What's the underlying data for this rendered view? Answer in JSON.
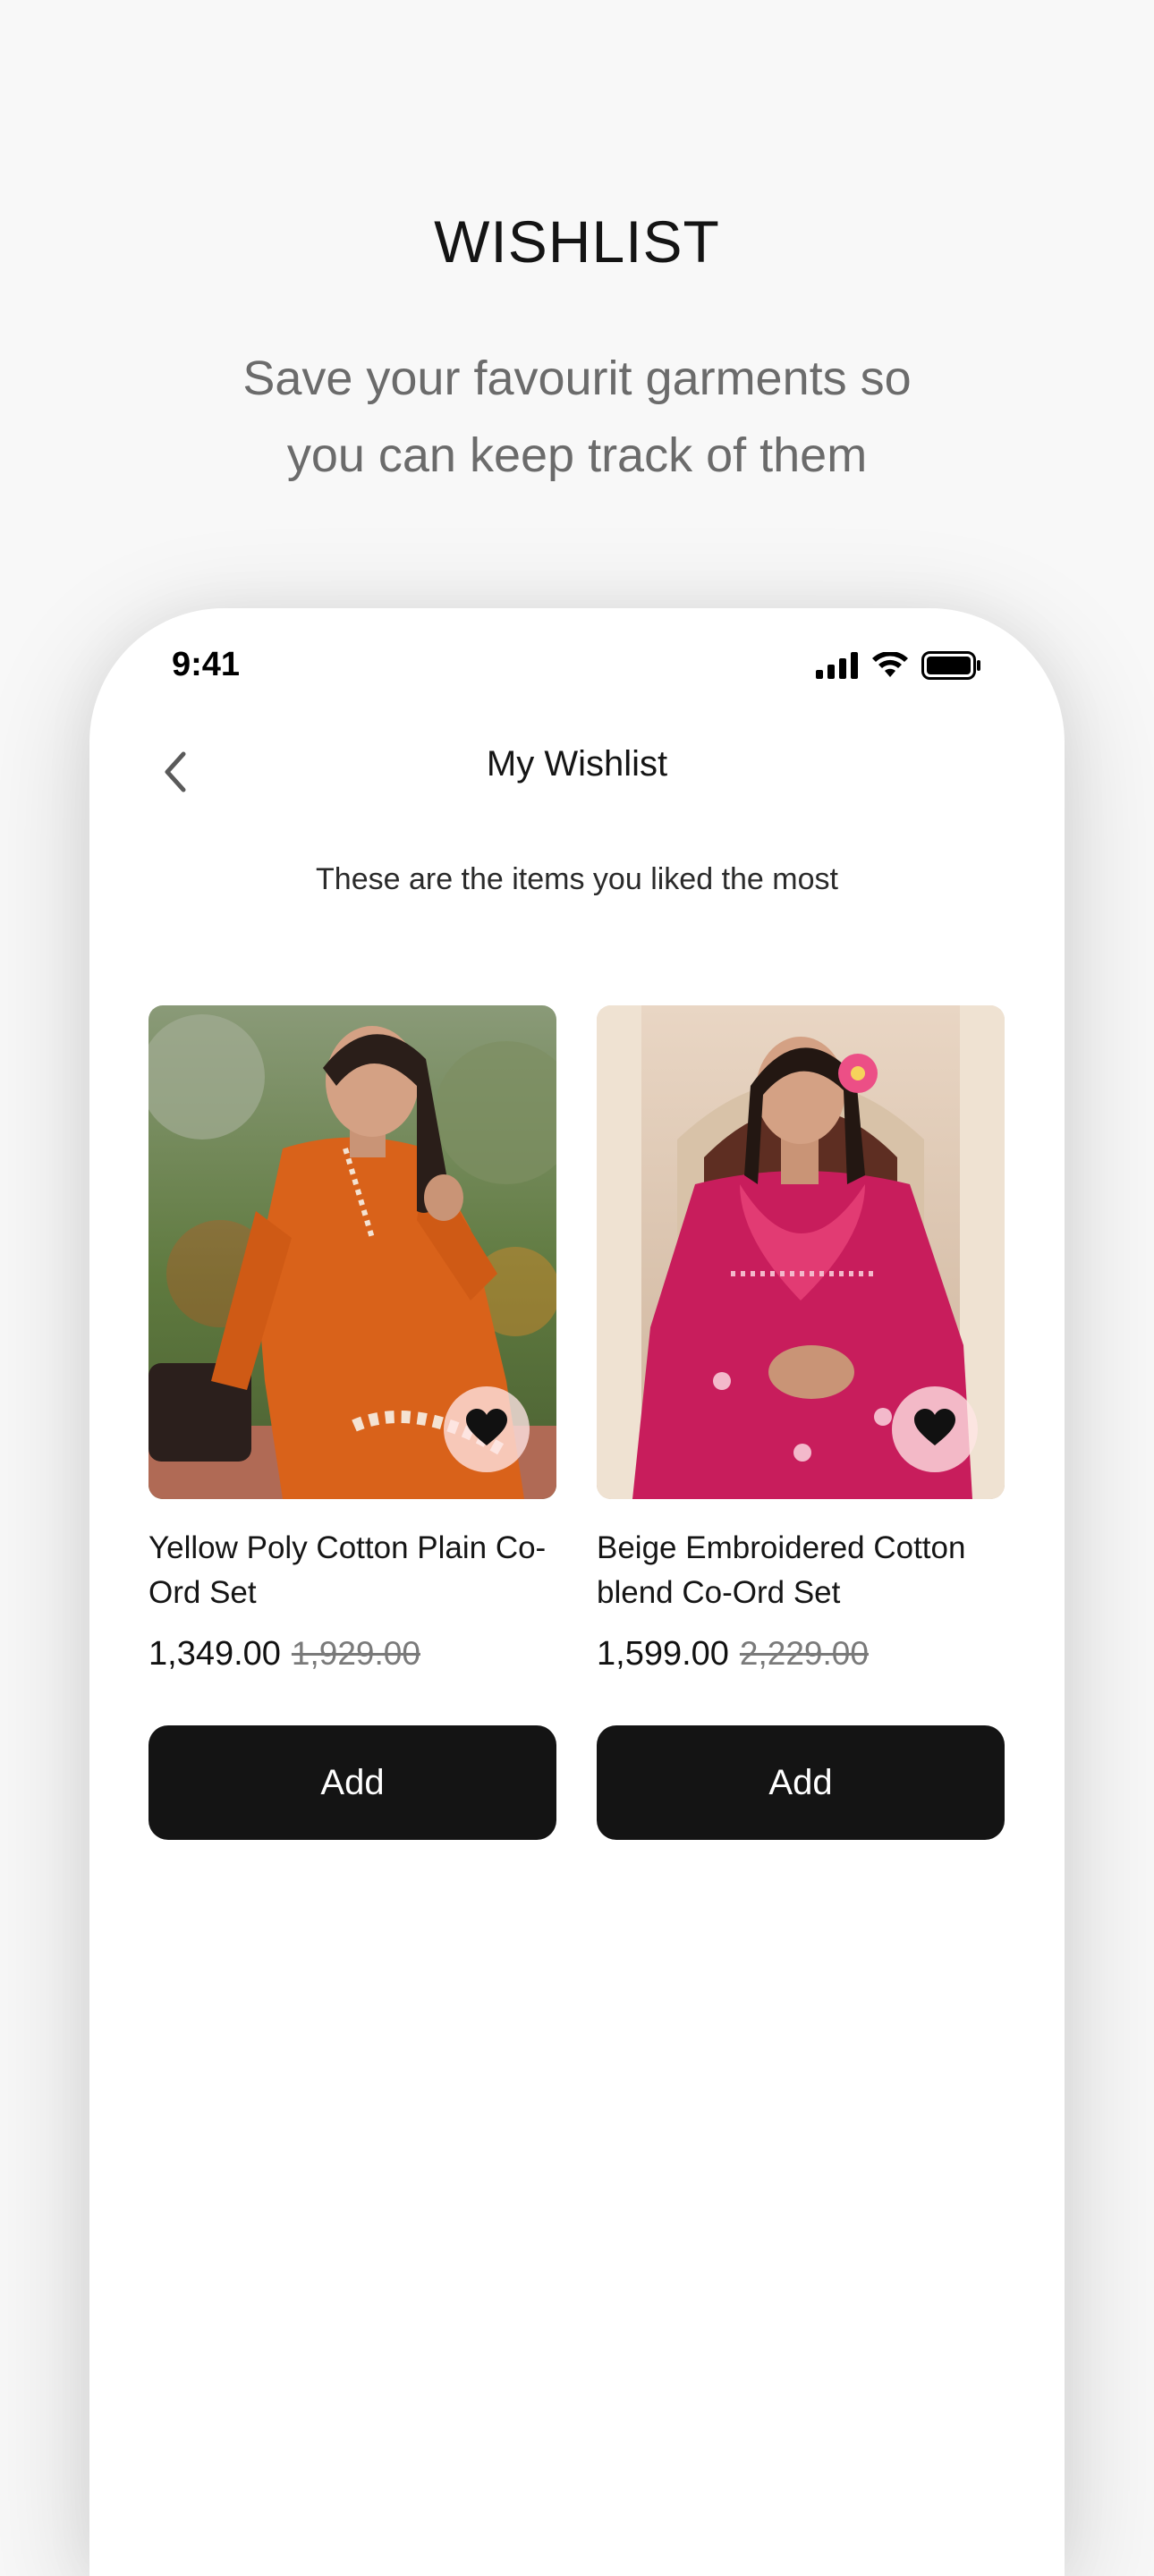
{
  "promo": {
    "title": "WISHLIST",
    "subtitle_line1": "Save your favourit garments so",
    "subtitle_line2": "you can keep track of them"
  },
  "status_bar": {
    "time": "9:41",
    "icons": [
      "cellular-signal-icon",
      "wifi-icon",
      "battery-icon"
    ]
  },
  "nav": {
    "back_icon": "chevron-left-icon",
    "title": "My Wishlist"
  },
  "subheading": "These are the items you liked the most",
  "products": [
    {
      "name": "Yellow Poly Cotton Plain Co-Ord Set",
      "price": "1,349.00",
      "original_price": "1,929.00",
      "favorite_icon": "heart-icon",
      "button_label": "Add",
      "garment_color": "#d9621a"
    },
    {
      "name": "Beige Embroidered Cotton blend Co-Ord Set",
      "price": "1,599.00",
      "original_price": "2,229.00",
      "favorite_icon": "heart-icon",
      "button_label": "Add",
      "garment_color": "#c81d5c"
    }
  ],
  "colors": {
    "background": "#f8f8f8",
    "button": "#141414",
    "button_text": "#ffffff",
    "strike_price": "#7a7a7a"
  }
}
